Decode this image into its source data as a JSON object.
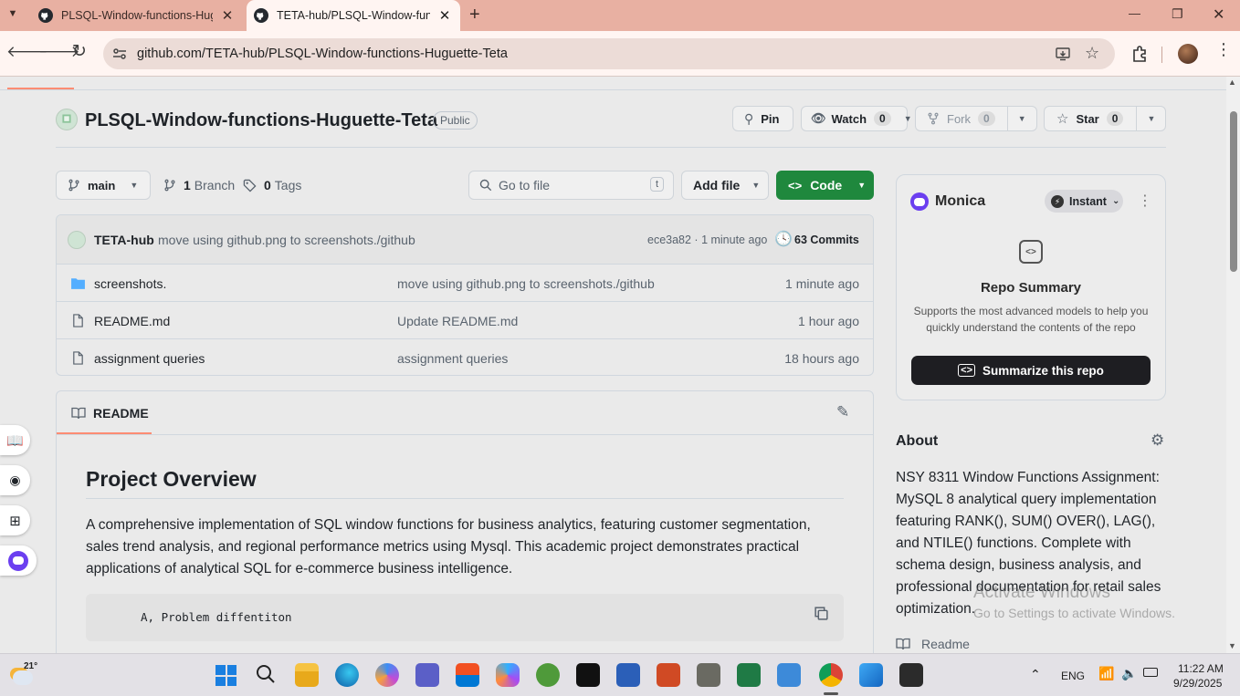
{
  "browser": {
    "tabs": [
      {
        "label": "PLSQL-Window-functions-Hugu",
        "close": "✕"
      },
      {
        "label": "TETA-hub/PLSQL-Window-func",
        "close": "✕"
      }
    ],
    "new_tab": "+",
    "window_controls": {
      "minimize": "—",
      "restore": "❐",
      "close": "✕"
    },
    "url": "github.com/TETA-hub/PLSQL-Window-functions-Huguette-Teta"
  },
  "repo": {
    "name": "PLSQL-Window-functions-Huguette-Teta",
    "visibility": "Public",
    "actions": {
      "pin": "Pin",
      "watch": "Watch",
      "watch_count": "0",
      "fork": "Fork",
      "fork_count": "0",
      "star": "Star",
      "star_count": "0"
    },
    "branch": "main",
    "branches_count": "1",
    "branches_label": "Branch",
    "tags_count": "0",
    "tags_label": "Tags",
    "search_placeholder": "Go to file",
    "search_key": "t",
    "add_file": "Add file",
    "code": "Code"
  },
  "latest_commit": {
    "author": "TETA-hub",
    "message": "move using github.png to screenshots./github",
    "hash_time": "ece3a82 · 1 minute ago",
    "commits": "63 Commits"
  },
  "files": [
    {
      "name": "screenshots.",
      "type": "folder",
      "message": "move using github.png to screenshots./github",
      "time": "1 minute ago"
    },
    {
      "name": "README.md",
      "type": "file",
      "message": "Update README.md",
      "time": "1 hour ago"
    },
    {
      "name": "assignment queries",
      "type": "file",
      "message": "assignment queries",
      "time": "18 hours ago"
    }
  ],
  "readme": {
    "tab": "README",
    "heading": "Project Overview",
    "paragraph": "A comprehensive implementation of SQL window functions for business analytics, featuring customer segmentation, sales trend analysis, and regional performance metrics using Mysql. This academic project demonstrates practical applications of analytical SQL for e-commerce business intelligence.",
    "code_block": "A, Problem diffentiton"
  },
  "monica": {
    "name": "Monica",
    "mode": "Instant",
    "title": "Repo Summary",
    "desc": "Supports the most advanced models to help you quickly understand the contents of the repo",
    "button": "Summarize this repo"
  },
  "about": {
    "title": "About",
    "text": "NSY 8311 Window Functions Assignment: MySQL 8 analytical query implementation featuring RANK(), SUM() OVER(), LAG(), and NTILE() functions. Complete with schema design, business analysis, and professional documentation for retail sales optimization.",
    "readme_link": "Readme"
  },
  "watermark": {
    "title": "Activate Windows",
    "sub": "Go to Settings to activate Windows."
  },
  "taskbar": {
    "temp": "21°",
    "lang": "ENG",
    "time": "11:22 AM",
    "date": "9/29/2025"
  },
  "colors": {
    "accent_green": "#1f883d",
    "tab_strip": "#e8b0a2",
    "monica_purple": "#6b3ff0"
  }
}
